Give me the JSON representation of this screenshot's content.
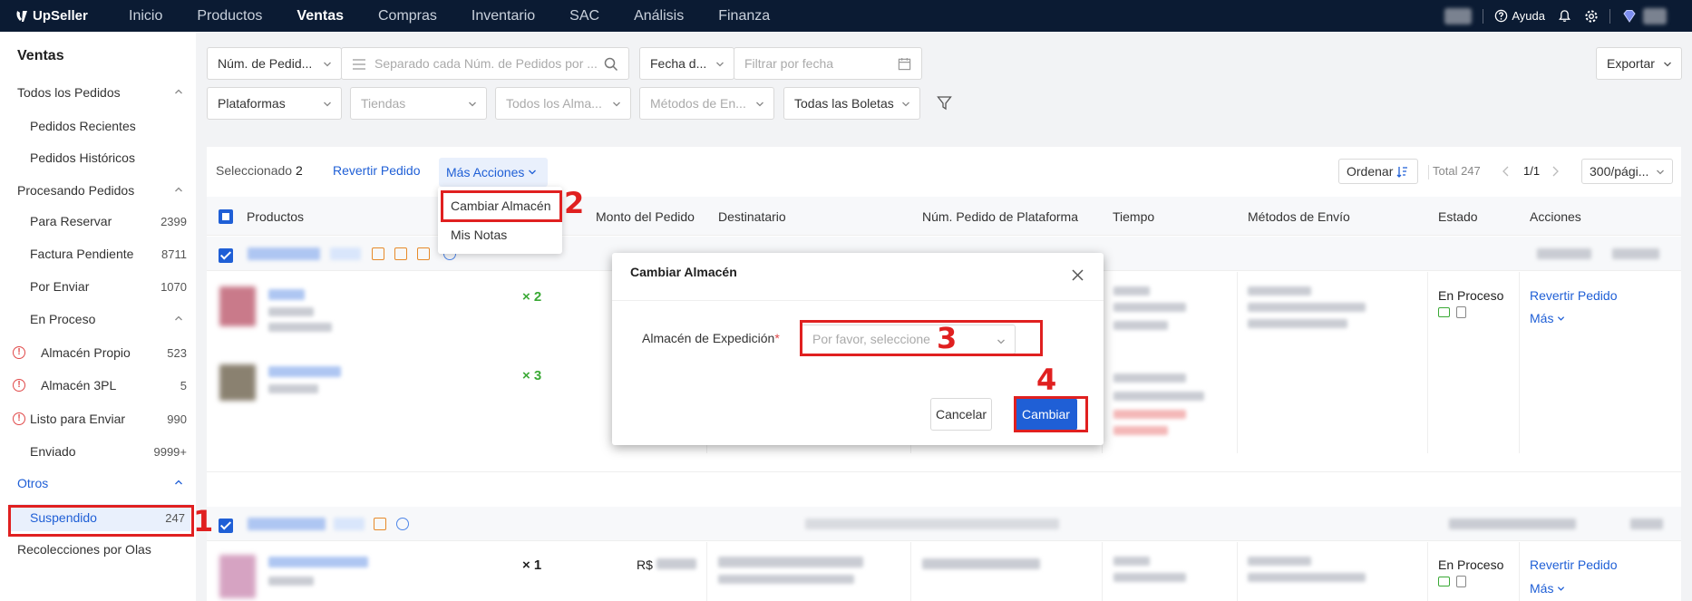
{
  "app": {
    "name": "UpSeller"
  },
  "topnav": {
    "items": [
      "Inicio",
      "Productos",
      "Ventas",
      "Compras",
      "Inventario",
      "SAC",
      "Análisis",
      "Finanza"
    ],
    "active_index": 2,
    "help_label": "Ayuda"
  },
  "sidebar": {
    "title": "Ventas",
    "items": [
      {
        "label": "Todos los Pedidos"
      },
      {
        "label": "Pedidos Recientes"
      },
      {
        "label": "Pedidos Históricos"
      },
      {
        "label": "Procesando Pedidos"
      },
      {
        "label": "Para Reservar",
        "count": "2399"
      },
      {
        "label": "Factura Pendiente",
        "count": "8711"
      },
      {
        "label": "Por Enviar",
        "count": "1070"
      },
      {
        "label": "En Proceso"
      },
      {
        "label": "Almacén Propio",
        "count": "523"
      },
      {
        "label": "Almacén 3PL",
        "count": "5"
      },
      {
        "label": "Listo para Enviar",
        "count": "990"
      },
      {
        "label": "Enviado",
        "count": "9999+"
      },
      {
        "label": "Otros"
      },
      {
        "label": "Suspendido",
        "count": "247"
      },
      {
        "label": "Recolecciones por Olas"
      }
    ]
  },
  "filters": {
    "order_number_select": "Núm. de Pedid...",
    "order_search_placeholder": "Separado cada Núm. de Pedidos por ...",
    "date_select": "Fecha d...",
    "date_placeholder": "Filtrar por fecha",
    "export_label": "Exportar",
    "platforms": "Plataformas",
    "stores": "Tiendas",
    "warehouses": "Todos los Alma...",
    "shipping_methods": "Métodos de En...",
    "tickets": "Todas las Boletas"
  },
  "toolbar": {
    "selected_label": "Seleccionado",
    "selected_count": "2",
    "revert_label": "Revertir Pedido",
    "more_actions_label": "Más Acciones",
    "sort_label": "Ordenar",
    "total_label": "Total 247",
    "page_label": "1/1",
    "page_size": "300/pági..."
  },
  "table": {
    "headers": [
      "Productos",
      "Monto del Pedido",
      "Destinatario",
      "Núm. Pedido de Plataforma",
      "Tiempo",
      "Métodos de Envío",
      "Estado",
      "Acciones"
    ],
    "orders": [
      {
        "quantities": [
          "× 2",
          "× 3"
        ],
        "status": "En Proceso",
        "action": "Revertir Pedido",
        "more": "Más"
      },
      {
        "quantities": [
          "× 1"
        ],
        "amount_prefix": "R$",
        "status": "En Proceso",
        "action": "Revertir Pedido",
        "more": "Más"
      }
    ]
  },
  "menu": {
    "items": [
      "Cambiar Almacén",
      "Mis Notas"
    ]
  },
  "modal": {
    "title": "Cambiar Almacén",
    "field_label": "Almacén de Expedición",
    "required_mark": "*",
    "select_placeholder": "Por favor, seleccione",
    "cancel_label": "Cancelar",
    "confirm_label": "Cambiar"
  },
  "annotations": [
    "1",
    "2",
    "3",
    "4"
  ],
  "colors": {
    "nav_bg": "#0b1b33",
    "accent": "#1f5fd6",
    "annotation": "#e02020",
    "qty_green": "#3aa935"
  }
}
